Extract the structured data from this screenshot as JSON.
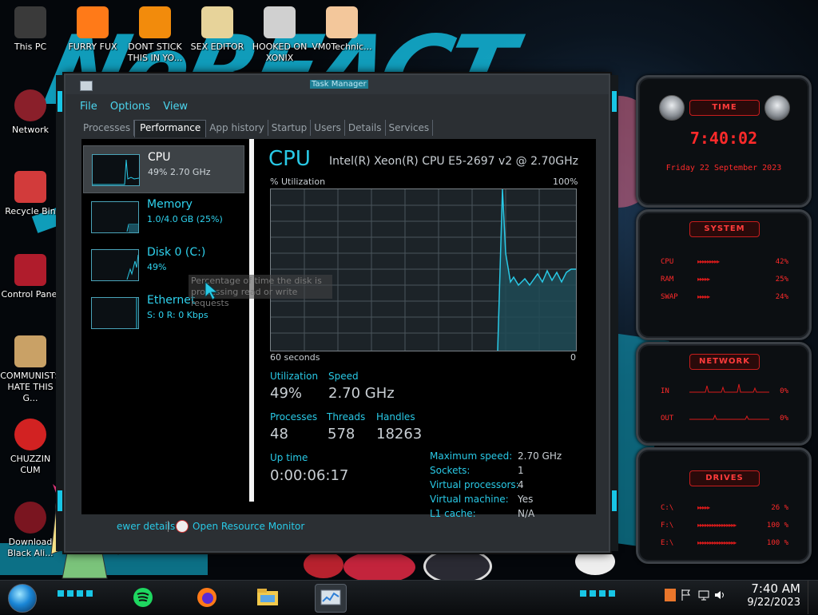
{
  "desktop": {
    "icons": [
      {
        "label": "This PC",
        "icon": "computer-icon"
      },
      {
        "label": "FURRY FUX",
        "icon": "firefox-icon"
      },
      {
        "label": "DONT STICK\nTHIS IN YO...",
        "icon": "vlc-cone-icon"
      },
      {
        "label": "SEX EDITOR",
        "icon": "hxd-editor-icon"
      },
      {
        "label": "HOOKED ON\nXONIX",
        "icon": "xonix-game-icon"
      },
      {
        "label": "VM0Technic...",
        "icon": "doctor-avatar-icon"
      },
      {
        "label": "Network",
        "icon": "network-icon"
      },
      {
        "label": "Recycle Bin",
        "icon": "recycle-bin-icon"
      },
      {
        "label": "Control Panel",
        "icon": "control-panel-icon"
      },
      {
        "label": "COMMUNISTS\nHATE THIS G...",
        "icon": "money-bag-icon"
      },
      {
        "label": "CHUZZIN\nCUM",
        "icon": "chuzzle-icon"
      },
      {
        "label": "Download\nBlack Ali...",
        "icon": "alien-download-icon"
      }
    ]
  },
  "task_manager": {
    "title": "Task Manager",
    "menu": [
      "File",
      "Options",
      "View"
    ],
    "tabs": [
      "Processes",
      "Performance",
      "App history",
      "Startup",
      "Users",
      "Details",
      "Services"
    ],
    "active_tab": "Performance",
    "sidebar": [
      {
        "name": "CPU",
        "sub": "49%  2.70 GHz",
        "selected": true
      },
      {
        "name": "Memory",
        "sub": "1.0/4.0 GB (25%)",
        "selected": false
      },
      {
        "name": "Disk 0 (C:)",
        "sub": "49%",
        "selected": false
      },
      {
        "name": "Ethernet",
        "sub": "S: 0  R: 0 Kbps",
        "selected": false
      }
    ],
    "cpu": {
      "title": "CPU",
      "model": "Intel(R) Xeon(R) CPU E5-2697 v2 @ 2.70GHz",
      "graph_label": "% Utilization",
      "graph_max": "100%",
      "graph_time": "60 seconds",
      "graph_zero": "0",
      "stats": {
        "utilization_label": "Utilization",
        "utilization": "49%",
        "speed_label": "Speed",
        "speed": "2.70 GHz",
        "processes_label": "Processes",
        "processes": "48",
        "threads_label": "Threads",
        "threads": "578",
        "handles_label": "Handles",
        "handles": "18263",
        "uptime_label": "Up time",
        "uptime": "0:00:06:17"
      },
      "specs": [
        {
          "key": "Maximum speed:",
          "value": "2.70 GHz"
        },
        {
          "key": "Sockets:",
          "value": "1"
        },
        {
          "key": "Virtual processors:",
          "value": "4"
        },
        {
          "key": "Virtual machine:",
          "value": "Yes"
        },
        {
          "key": "L1 cache:",
          "value": "N/A"
        }
      ]
    },
    "tooltip": "Percentage of time the disk is processing read or write requests",
    "footer": {
      "fewer_details": "ewer details",
      "open_resource_monitor": "Open Resource Monitor"
    }
  },
  "widgets": {
    "time": {
      "header": "TIME",
      "time": "7:40:02",
      "date": "Friday 22 September 2023"
    },
    "system": {
      "header": "SYSTEM",
      "rows": [
        {
          "label": "CPU",
          "value": "42%"
        },
        {
          "label": "RAM",
          "value": "25%"
        },
        {
          "label": "SWAP",
          "value": "24%"
        }
      ]
    },
    "network": {
      "header": "NETWORK",
      "rows": [
        {
          "label": "IN",
          "value": "0%"
        },
        {
          "label": "OUT",
          "value": "0%"
        }
      ]
    },
    "drives": {
      "header": "DRIVES",
      "rows": [
        {
          "label": "C:\\",
          "value": "26 %"
        },
        {
          "label": "F:\\",
          "value": "100 %"
        },
        {
          "label": "E:\\",
          "value": "100 %"
        }
      ]
    }
  },
  "taskbar": {
    "apps": [
      "spotify-icon",
      "firefox-icon",
      "file-explorer-icon",
      "task-manager-icon"
    ],
    "clock_time": "7:40 AM",
    "clock_date": "9/22/2023"
  },
  "colors": {
    "accent": "#29c9e6",
    "widget_red": "#ff2a2a"
  }
}
